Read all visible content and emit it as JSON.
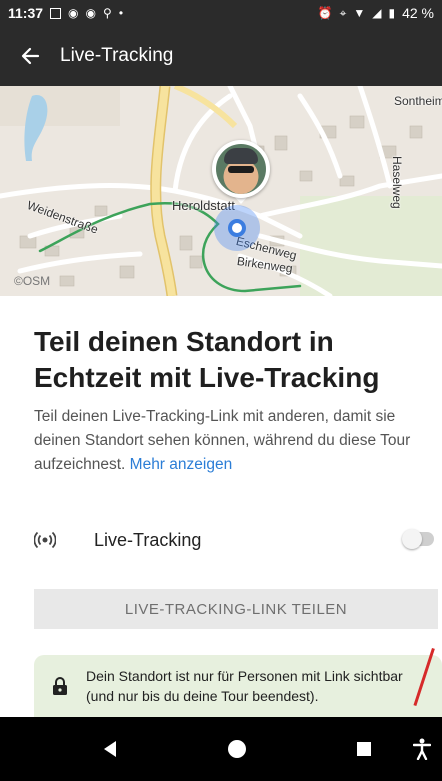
{
  "status_bar": {
    "time": "11:37",
    "battery": "42 %",
    "icons_left": [
      "b-app-icon",
      "opera-icon",
      "opera-icon",
      "bike-icon",
      "dot-icon"
    ],
    "icons_right": [
      "alarm-icon",
      "location-icon",
      "wifi-icon",
      "signal-icon",
      "battery-icon"
    ]
  },
  "app_bar": {
    "back_icon": "arrow-left-icon",
    "title": "Live-Tracking"
  },
  "map": {
    "labels": {
      "heroldstatt": "Heroldstatt",
      "sontheim": "Sontheim",
      "haselweg": "Haselweg",
      "weidenstrasse": "Weidenstraße",
      "eschenweg": "Eschenweg",
      "birkenweg": "Birkenweg"
    },
    "attribution": "©OSM",
    "colors": {
      "route": "#3da35a",
      "location": "#3b7de0",
      "road_main": "#f7e39e"
    }
  },
  "content": {
    "headline": "Teil deinen Standort in Echtzeit mit Live-Tracking",
    "description": "Teil deinen Live-Tracking-Link mit anderen, damit sie deinen Standort sehen können, während du diese Tour aufzeichnest.",
    "more_link": "Mehr anzeigen",
    "toggle_label": "Live-Tracking",
    "toggle_state": "off",
    "share_button": "LIVE-TRACKING-LINK TEILEN",
    "info_text": "Dein Standort ist nur für Personen mit Link sichtbar (und nur bis du deine Tour beendest)."
  },
  "nav_bar": {
    "buttons": [
      "back-triangle-icon",
      "home-circle-icon",
      "recents-square-icon",
      "accessibility-icon"
    ]
  }
}
